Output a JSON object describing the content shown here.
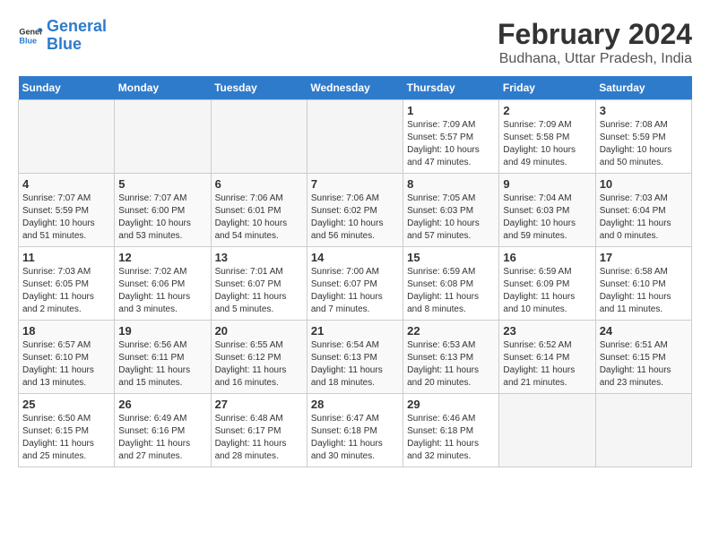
{
  "header": {
    "logo_line1": "General",
    "logo_line2": "Blue",
    "main_title": "February 2024",
    "subtitle": "Budhana, Uttar Pradesh, India"
  },
  "days_of_week": [
    "Sunday",
    "Monday",
    "Tuesday",
    "Wednesday",
    "Thursday",
    "Friday",
    "Saturday"
  ],
  "weeks": [
    [
      {
        "day": "",
        "sunrise": "",
        "sunset": "",
        "daylight": ""
      },
      {
        "day": "",
        "sunrise": "",
        "sunset": "",
        "daylight": ""
      },
      {
        "day": "",
        "sunrise": "",
        "sunset": "",
        "daylight": ""
      },
      {
        "day": "",
        "sunrise": "",
        "sunset": "",
        "daylight": ""
      },
      {
        "day": "1",
        "sunrise": "Sunrise: 7:09 AM",
        "sunset": "Sunset: 5:57 PM",
        "daylight": "Daylight: 10 hours and 47 minutes."
      },
      {
        "day": "2",
        "sunrise": "Sunrise: 7:09 AM",
        "sunset": "Sunset: 5:58 PM",
        "daylight": "Daylight: 10 hours and 49 minutes."
      },
      {
        "day": "3",
        "sunrise": "Sunrise: 7:08 AM",
        "sunset": "Sunset: 5:59 PM",
        "daylight": "Daylight: 10 hours and 50 minutes."
      }
    ],
    [
      {
        "day": "4",
        "sunrise": "Sunrise: 7:07 AM",
        "sunset": "Sunset: 5:59 PM",
        "daylight": "Daylight: 10 hours and 51 minutes."
      },
      {
        "day": "5",
        "sunrise": "Sunrise: 7:07 AM",
        "sunset": "Sunset: 6:00 PM",
        "daylight": "Daylight: 10 hours and 53 minutes."
      },
      {
        "day": "6",
        "sunrise": "Sunrise: 7:06 AM",
        "sunset": "Sunset: 6:01 PM",
        "daylight": "Daylight: 10 hours and 54 minutes."
      },
      {
        "day": "7",
        "sunrise": "Sunrise: 7:06 AM",
        "sunset": "Sunset: 6:02 PM",
        "daylight": "Daylight: 10 hours and 56 minutes."
      },
      {
        "day": "8",
        "sunrise": "Sunrise: 7:05 AM",
        "sunset": "Sunset: 6:03 PM",
        "daylight": "Daylight: 10 hours and 57 minutes."
      },
      {
        "day": "9",
        "sunrise": "Sunrise: 7:04 AM",
        "sunset": "Sunset: 6:03 PM",
        "daylight": "Daylight: 10 hours and 59 minutes."
      },
      {
        "day": "10",
        "sunrise": "Sunrise: 7:03 AM",
        "sunset": "Sunset: 6:04 PM",
        "daylight": "Daylight: 11 hours and 0 minutes."
      }
    ],
    [
      {
        "day": "11",
        "sunrise": "Sunrise: 7:03 AM",
        "sunset": "Sunset: 6:05 PM",
        "daylight": "Daylight: 11 hours and 2 minutes."
      },
      {
        "day": "12",
        "sunrise": "Sunrise: 7:02 AM",
        "sunset": "Sunset: 6:06 PM",
        "daylight": "Daylight: 11 hours and 3 minutes."
      },
      {
        "day": "13",
        "sunrise": "Sunrise: 7:01 AM",
        "sunset": "Sunset: 6:07 PM",
        "daylight": "Daylight: 11 hours and 5 minutes."
      },
      {
        "day": "14",
        "sunrise": "Sunrise: 7:00 AM",
        "sunset": "Sunset: 6:07 PM",
        "daylight": "Daylight: 11 hours and 7 minutes."
      },
      {
        "day": "15",
        "sunrise": "Sunrise: 6:59 AM",
        "sunset": "Sunset: 6:08 PM",
        "daylight": "Daylight: 11 hours and 8 minutes."
      },
      {
        "day": "16",
        "sunrise": "Sunrise: 6:59 AM",
        "sunset": "Sunset: 6:09 PM",
        "daylight": "Daylight: 11 hours and 10 minutes."
      },
      {
        "day": "17",
        "sunrise": "Sunrise: 6:58 AM",
        "sunset": "Sunset: 6:10 PM",
        "daylight": "Daylight: 11 hours and 11 minutes."
      }
    ],
    [
      {
        "day": "18",
        "sunrise": "Sunrise: 6:57 AM",
        "sunset": "Sunset: 6:10 PM",
        "daylight": "Daylight: 11 hours and 13 minutes."
      },
      {
        "day": "19",
        "sunrise": "Sunrise: 6:56 AM",
        "sunset": "Sunset: 6:11 PM",
        "daylight": "Daylight: 11 hours and 15 minutes."
      },
      {
        "day": "20",
        "sunrise": "Sunrise: 6:55 AM",
        "sunset": "Sunset: 6:12 PM",
        "daylight": "Daylight: 11 hours and 16 minutes."
      },
      {
        "day": "21",
        "sunrise": "Sunrise: 6:54 AM",
        "sunset": "Sunset: 6:13 PM",
        "daylight": "Daylight: 11 hours and 18 minutes."
      },
      {
        "day": "22",
        "sunrise": "Sunrise: 6:53 AM",
        "sunset": "Sunset: 6:13 PM",
        "daylight": "Daylight: 11 hours and 20 minutes."
      },
      {
        "day": "23",
        "sunrise": "Sunrise: 6:52 AM",
        "sunset": "Sunset: 6:14 PM",
        "daylight": "Daylight: 11 hours and 21 minutes."
      },
      {
        "day": "24",
        "sunrise": "Sunrise: 6:51 AM",
        "sunset": "Sunset: 6:15 PM",
        "daylight": "Daylight: 11 hours and 23 minutes."
      }
    ],
    [
      {
        "day": "25",
        "sunrise": "Sunrise: 6:50 AM",
        "sunset": "Sunset: 6:15 PM",
        "daylight": "Daylight: 11 hours and 25 minutes."
      },
      {
        "day": "26",
        "sunrise": "Sunrise: 6:49 AM",
        "sunset": "Sunset: 6:16 PM",
        "daylight": "Daylight: 11 hours and 27 minutes."
      },
      {
        "day": "27",
        "sunrise": "Sunrise: 6:48 AM",
        "sunset": "Sunset: 6:17 PM",
        "daylight": "Daylight: 11 hours and 28 minutes."
      },
      {
        "day": "28",
        "sunrise": "Sunrise: 6:47 AM",
        "sunset": "Sunset: 6:18 PM",
        "daylight": "Daylight: 11 hours and 30 minutes."
      },
      {
        "day": "29",
        "sunrise": "Sunrise: 6:46 AM",
        "sunset": "Sunset: 6:18 PM",
        "daylight": "Daylight: 11 hours and 32 minutes."
      },
      {
        "day": "",
        "sunrise": "",
        "sunset": "",
        "daylight": ""
      },
      {
        "day": "",
        "sunrise": "",
        "sunset": "",
        "daylight": ""
      }
    ]
  ]
}
